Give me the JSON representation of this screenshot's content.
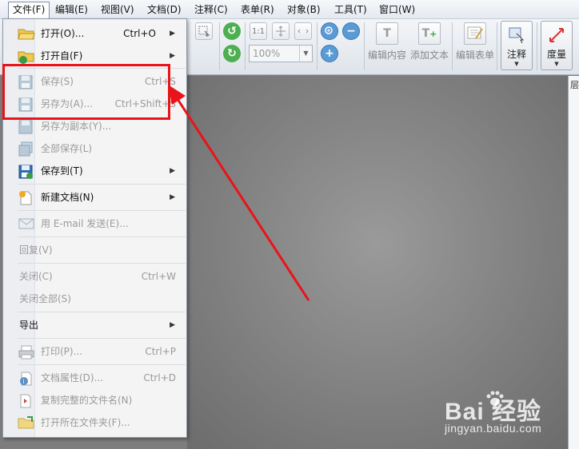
{
  "menubar": {
    "items": [
      "文件(F)",
      "编辑(E)",
      "视图(V)",
      "文档(D)",
      "注释(C)",
      "表单(R)",
      "对象(B)",
      "工具(T)",
      "窗口(W)"
    ]
  },
  "toolbar": {
    "zoom_value": "100%",
    "zoom_fit_label": "1:1",
    "edit_content_label": "编辑内容",
    "add_text_label": "添加文本",
    "edit_form_label": "编辑表单",
    "annotate_label": "注释",
    "measure_label": "度量"
  },
  "right_panel": {
    "tab_label": "层"
  },
  "file_menu": {
    "items": [
      {
        "label": "打开(O)...",
        "shortcut": "Ctrl+O",
        "submenu": "▶",
        "icon": "folder-open-icon"
      },
      {
        "label": "打开自(F)",
        "shortcut": "",
        "submenu": "▶",
        "icon": "folder-web-icon"
      },
      {
        "label": "保存(S)",
        "shortcut": "Ctrl+S",
        "submenu": "",
        "icon": "floppy-disk-icon"
      },
      {
        "label": "另存为(A)...",
        "shortcut": "Ctrl+Shift+S",
        "submenu": "",
        "icon": "floppy-save-as-icon"
      },
      {
        "label": "另存为副本(Y)...",
        "shortcut": "",
        "submenu": "",
        "icon": "floppy-copy-icon"
      },
      {
        "label": "全部保存(L)",
        "shortcut": "",
        "submenu": "",
        "icon": "floppy-stack-icon"
      },
      {
        "label": "保存到(T)",
        "shortcut": "",
        "submenu": "▶",
        "icon": "floppy-save-to-icon"
      },
      {
        "label": "新建文档(N)",
        "shortcut": "",
        "submenu": "▶",
        "icon": "new-document-icon"
      },
      {
        "label": "用 E-mail 发送(E)...",
        "shortcut": "",
        "submenu": "",
        "icon": "email-icon"
      },
      {
        "label": "回复(V)",
        "shortcut": "",
        "submenu": ""
      },
      {
        "label": "关闭(C)",
        "shortcut": "Ctrl+W",
        "submenu": ""
      },
      {
        "label": "关闭全部(S)",
        "shortcut": "",
        "submenu": ""
      },
      {
        "label": "导出",
        "shortcut": "",
        "submenu": "▶"
      },
      {
        "label": "打印(P)...",
        "shortcut": "Ctrl+P",
        "submenu": "",
        "icon": "printer-icon"
      },
      {
        "label": "文档属性(D)...",
        "shortcut": "Ctrl+D",
        "submenu": "",
        "icon": "info-icon"
      },
      {
        "label": "复制完整的文件名(N)",
        "shortcut": "",
        "submenu": "",
        "icon": "copy-filename-icon"
      },
      {
        "label": "打开所在文件夹(F)...",
        "shortcut": "",
        "submenu": "",
        "icon": "folder-locate-icon"
      }
    ]
  },
  "watermark": {
    "logo": "Bai 经验",
    "url": "jingyan.baidu.com"
  },
  "colors": {
    "highlight_red": "#e8141a",
    "menu_bg": "#f4f4f4",
    "document_bg": "#818181"
  }
}
